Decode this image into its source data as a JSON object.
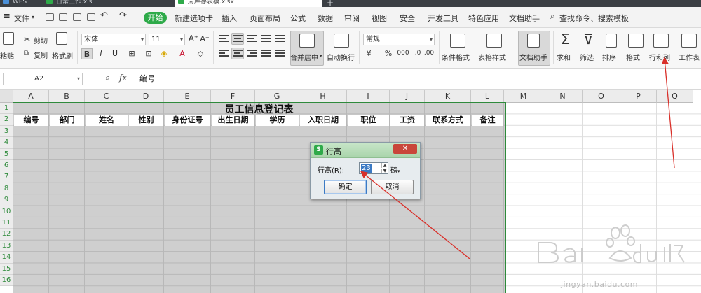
{
  "titlebar": {
    "tabs": [
      {
        "label": "WPS",
        "color": "#4a90d9",
        "active": false
      },
      {
        "label": "日常工作.xls",
        "color": "#2eaa49",
        "active": false
      },
      {
        "label": "周库存表模.xlsx",
        "color": "#2eaa49",
        "active": true
      }
    ],
    "new_tab": "+"
  },
  "menubar": {
    "file": "文件",
    "file_arrow": "▾",
    "start": "开始",
    "tabs": [
      "新建选项卡",
      "插入",
      "页面布局",
      "公式",
      "数据",
      "审阅",
      "视图",
      "安全",
      "开发工具",
      "特色应用",
      "文档助手"
    ],
    "search": "查找命令、搜索模板"
  },
  "ribbon": {
    "paste": "粘贴",
    "cut": "剪切",
    "copy": "复制",
    "format_painter": "格式刷",
    "font_name": "宋体",
    "font_size": "11",
    "bold": "B",
    "italic": "I",
    "underline": "U",
    "merge_center": "合并居中",
    "wrap": "自动换行",
    "number_format": "常规",
    "currency": "¥",
    "percent": "%",
    "thousands": "000",
    "cond_format": "条件格式",
    "table_style": "表格样式",
    "doc_assistant": "文档助手",
    "sum": "求和",
    "filter": "筛选",
    "sort": "排序",
    "format": "格式",
    "rows_cols": "行和列",
    "worksheet": "工作表"
  },
  "formula_bar": {
    "cell_ref": "A2",
    "fx": "fx",
    "content": "编号"
  },
  "sheet": {
    "columns": [
      "A",
      "B",
      "C",
      "D",
      "E",
      "F",
      "G",
      "H",
      "I",
      "J",
      "K",
      "L",
      "M",
      "N",
      "O",
      "P",
      "Q"
    ],
    "rows": [
      "1",
      "2",
      "3",
      "4",
      "5",
      "6",
      "7",
      "8",
      "9",
      "10",
      "11",
      "12",
      "13",
      "14",
      "15",
      "16"
    ],
    "title": "员工信息登记表",
    "headers": [
      "编号",
      "部门",
      "姓名",
      "性别",
      "身份证号",
      "出生日期",
      "学历",
      "入职日期",
      "职位",
      "工资",
      "联系方式",
      "备注"
    ]
  },
  "dialog": {
    "title": "行高",
    "label": "行高(R):",
    "value": "23",
    "unit": "磅",
    "ok": "确定",
    "cancel": "取消"
  },
  "watermark": {
    "text": "jingyan.baidu.com"
  },
  "colors": {
    "accent_green": "#2eaa49",
    "annotation_red": "#d9302a",
    "selection_border": "#2e8a3b"
  }
}
